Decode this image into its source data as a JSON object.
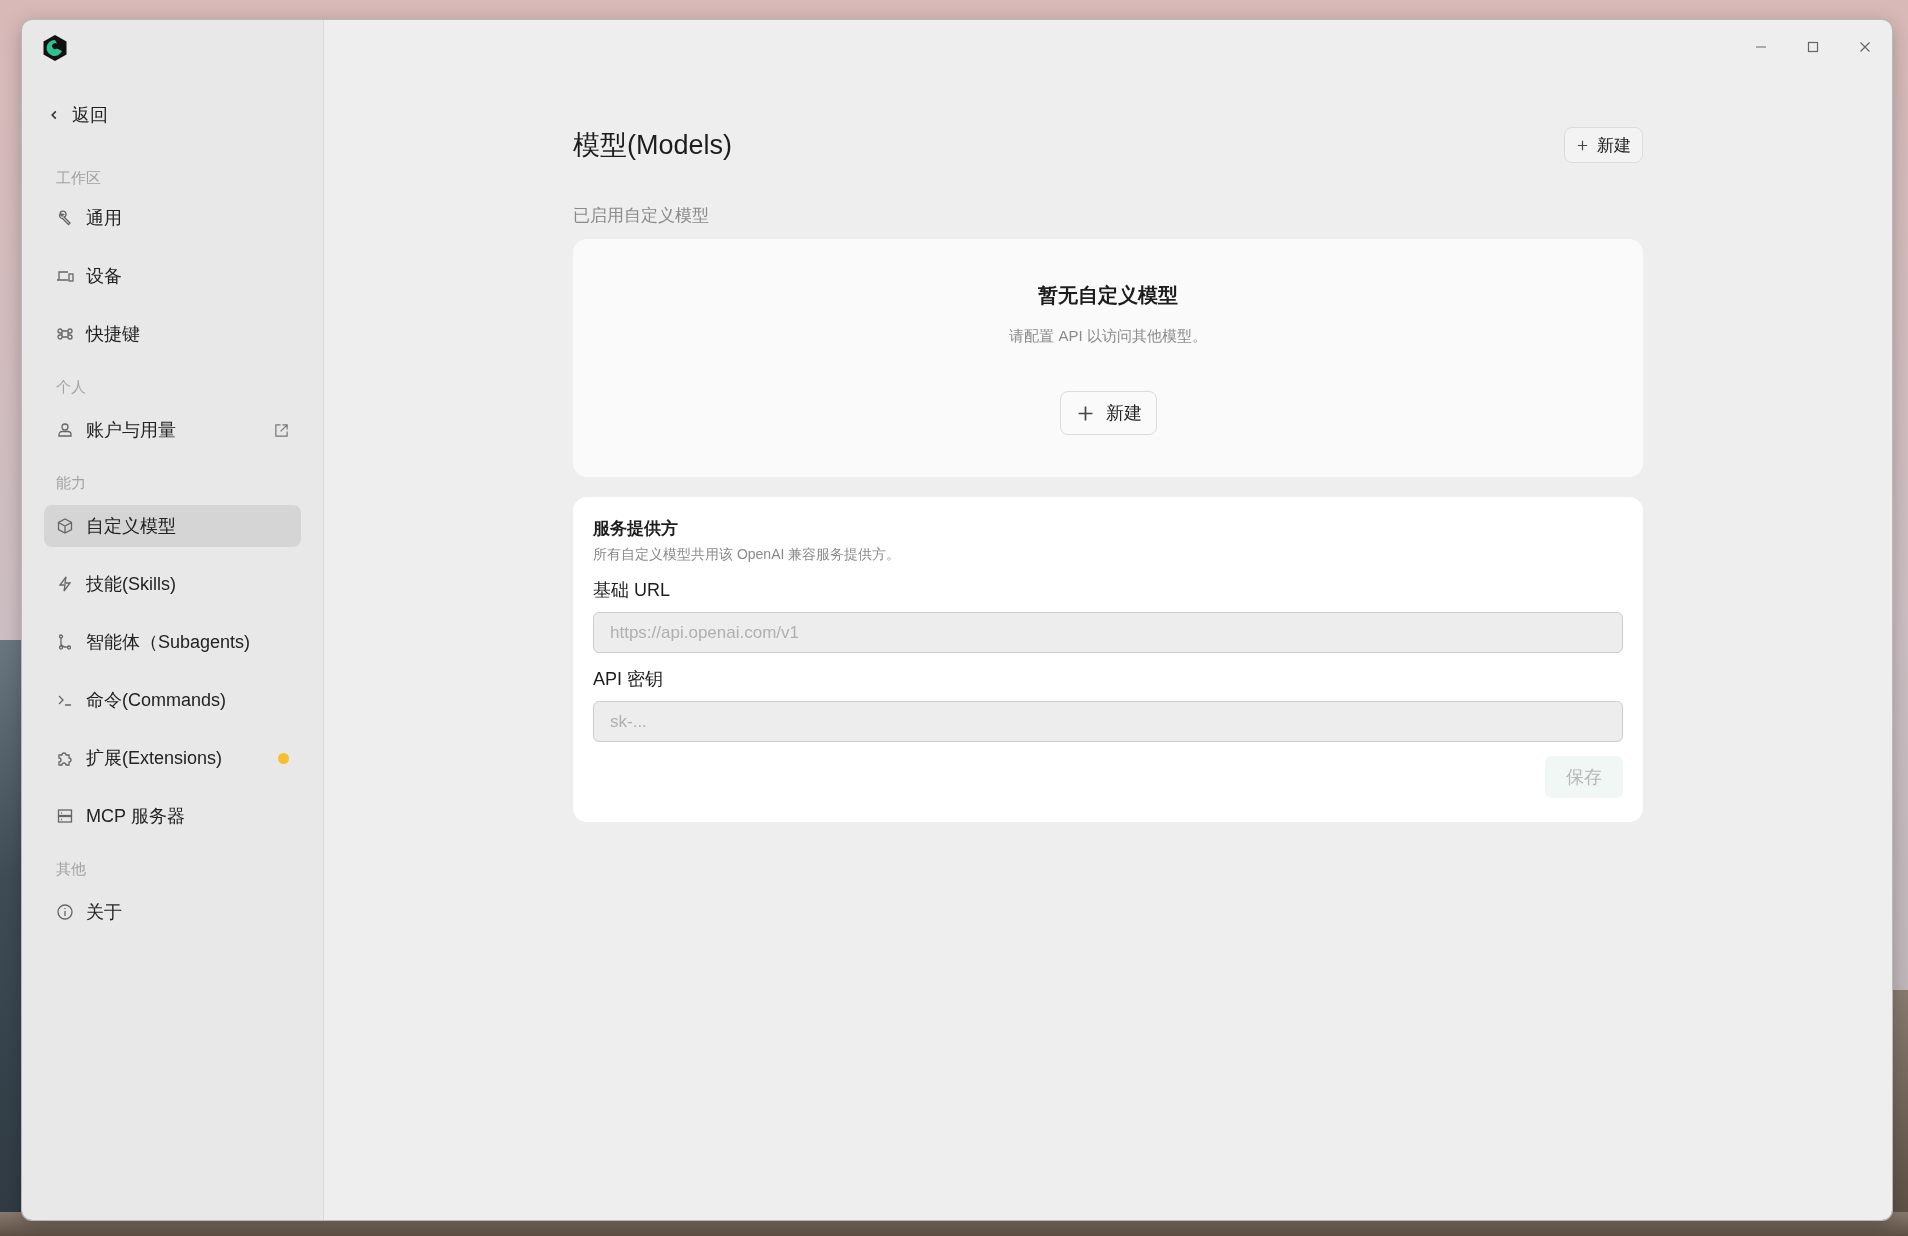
{
  "sidebar": {
    "back": "返回",
    "groups": [
      {
        "label": "工作区",
        "items": [
          {
            "label": "通用",
            "selected": false,
            "external_link": false
          },
          {
            "label": "设备",
            "selected": false,
            "external_link": false
          },
          {
            "label": "快捷键",
            "selected": false,
            "external_link": false
          }
        ]
      },
      {
        "label": "个人",
        "items": [
          {
            "label": "账户与用量",
            "selected": false,
            "external_link": true
          }
        ]
      },
      {
        "label": "能力",
        "items": [
          {
            "label": "自定义模型",
            "selected": true,
            "external_link": false
          },
          {
            "label": "技能(Skills)",
            "selected": false,
            "external_link": false
          },
          {
            "label": "智能体（Subagents)",
            "selected": false,
            "external_link": false
          },
          {
            "label": "命令(Commands)",
            "selected": false,
            "external_link": false
          },
          {
            "label": "扩展(Extensions)",
            "selected": false,
            "external_link": false,
            "color": "#f7bf2e"
          },
          {
            "label": "MCP 服务器",
            "selected": false,
            "external_link": false
          }
        ]
      },
      {
        "label": "其他",
        "items": [
          {
            "label": "关于",
            "selected": false,
            "external_link": false
          }
        ]
      }
    ]
  },
  "main": {
    "title": "模型(Models)",
    "new_button": "新建",
    "section_label": "已启用自定义模型",
    "empty_state": {
      "title": "暂无自定义模型",
      "hint": "请配置 API 以访问其他模型。",
      "button": "新建"
    },
    "provider": {
      "title": "服务提供方",
      "description": "所有自定义模型共用该 OpenAI 兼容服务提供方。",
      "fields": [
        {
          "label": "基础 URL",
          "placeholder": "https://api.openai.com/v1"
        },
        {
          "label": "API 密钥",
          "placeholder": "sk-..."
        }
      ],
      "save": {
        "label": "保存",
        "disabled": true
      }
    }
  }
}
